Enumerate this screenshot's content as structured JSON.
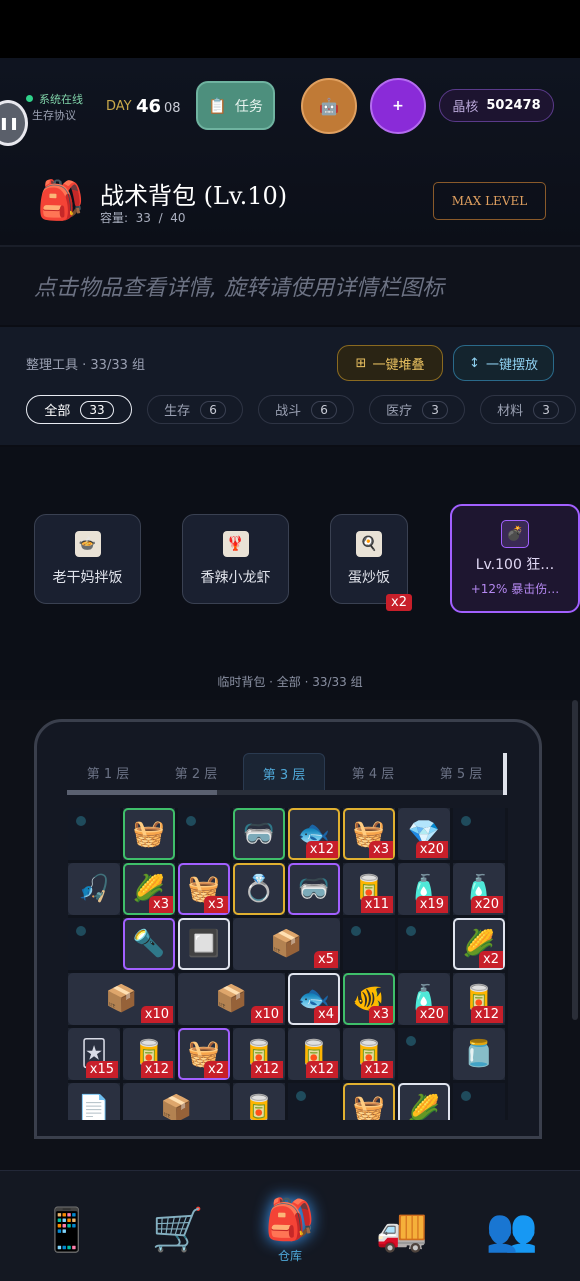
{
  "hud": {
    "status_online": "系统在线",
    "protocol": "生存协议",
    "day_label": "DAY",
    "day_number": "46",
    "day_sub": "08",
    "task_label": "任务",
    "plus_label": "+",
    "core_label": "晶核",
    "core_value": "502478"
  },
  "backpack": {
    "title": "战术背包 (Lv.10)",
    "capacity": "容量:  33  /  40",
    "max_level": "MAX LEVEL"
  },
  "hint": "点击物品查看详情, 旋转请使用详情栏图标",
  "tools": {
    "title": "整理工具 · 33/33 组",
    "stack_label": "一键堆叠",
    "place_label": "一键摆放"
  },
  "filters": [
    {
      "label": "全部",
      "count": "33"
    },
    {
      "label": "生存",
      "count": "6"
    },
    {
      "label": "战斗",
      "count": "6"
    },
    {
      "label": "医疗",
      "count": "3"
    },
    {
      "label": "材料",
      "count": "3"
    }
  ],
  "temp_items": [
    {
      "label": "老干妈拌饭",
      "icon": "bowl-icon"
    },
    {
      "label": "香辣小龙虾",
      "icon": "crayfish-icon"
    },
    {
      "label": "蛋炒饭",
      "icon": "fried-rice-icon",
      "badge": "x2"
    }
  ],
  "feature_card": {
    "title": "Lv.100 狂…",
    "sub": "+12% 暴击伤…"
  },
  "temp_bag_caption": "临时背包 · 全部 · 33/33 组",
  "layers": [
    "第 1 层",
    "第 2 层",
    "第 3 层",
    "第 4 层",
    "第 5 层"
  ],
  "active_layer": 2,
  "grid_items": [
    {
      "icon": "tomato-basket-icon",
      "glyph": "🧺",
      "frame": "green",
      "badge": ""
    },
    {
      "icon": "goggles-icon",
      "glyph": "🥽",
      "frame": "green",
      "badge": ""
    },
    {
      "icon": "fish-icon",
      "glyph": "🐟",
      "frame": "gold",
      "badge": "x12"
    },
    {
      "icon": "tomato-basket-icon",
      "glyph": "🧺",
      "frame": "gold",
      "badge": "x3"
    },
    {
      "icon": "red-crystal-icon",
      "glyph": "💎",
      "frame": "plain",
      "badge": "x20"
    },
    {
      "icon": "fishing-rod-icon",
      "glyph": "🎣",
      "frame": "plain",
      "badge": ""
    },
    {
      "icon": "corn-basket-icon",
      "glyph": "🌽",
      "frame": "green",
      "badge": "x3"
    },
    {
      "icon": "tomato-basket-icon",
      "glyph": "🧺",
      "frame": "purple",
      "badge": "x3"
    },
    {
      "icon": "ring-icon",
      "glyph": "💍",
      "frame": "gold",
      "badge": ""
    },
    {
      "icon": "goggles-icon",
      "glyph": "🥽",
      "frame": "purple",
      "badge": ""
    },
    {
      "icon": "soda-can-icon",
      "glyph": "🥫",
      "frame": "plain",
      "badge": "x11"
    },
    {
      "icon": "water-bottle-icon",
      "glyph": "🧴",
      "frame": "plain",
      "badge": "x19"
    },
    {
      "icon": "water-bottle-icon",
      "glyph": "🧴",
      "frame": "plain",
      "badge": "x20"
    },
    {
      "icon": "lantern-icon",
      "glyph": "🔦",
      "frame": "purple",
      "badge": ""
    },
    {
      "icon": "chip-icon",
      "glyph": "🔲",
      "frame": "white",
      "badge": ""
    },
    {
      "icon": "ammo-box-icon",
      "glyph": "📦",
      "frame": "plain",
      "badge": "x5"
    },
    {
      "icon": "corn-basket-icon",
      "glyph": "🌽",
      "frame": "white",
      "badge": "x2"
    },
    {
      "icon": "ammo-box-icon",
      "glyph": "📦",
      "frame": "plain",
      "badge": "x10"
    },
    {
      "icon": "ammo-box-icon",
      "glyph": "📦",
      "frame": "plain",
      "badge": "x10"
    },
    {
      "icon": "fish-icon",
      "glyph": "🐟",
      "frame": "white",
      "badge": "x4"
    },
    {
      "icon": "yellow-fish-icon",
      "glyph": "🐠",
      "frame": "green",
      "badge": "x3"
    },
    {
      "icon": "water-bottle-icon",
      "glyph": "🧴",
      "frame": "plain",
      "badge": "x20"
    },
    {
      "icon": "soda-can-icon",
      "glyph": "🥫",
      "frame": "plain",
      "badge": "x12"
    },
    {
      "icon": "cards-icon",
      "glyph": "🃏",
      "frame": "plain",
      "badge": "x15"
    },
    {
      "icon": "soda-can-icon",
      "glyph": "🥫",
      "frame": "plain",
      "badge": "x12"
    },
    {
      "icon": "tomato-basket-icon",
      "glyph": "🧺",
      "frame": "purple",
      "badge": "x2"
    },
    {
      "icon": "soda-can-icon",
      "glyph": "🥫",
      "frame": "plain",
      "badge": "x12"
    },
    {
      "icon": "soda-can-icon",
      "glyph": "🥫",
      "frame": "plain",
      "badge": "x12"
    },
    {
      "icon": "soda-can-icon",
      "glyph": "🥫",
      "frame": "plain",
      "badge": "x12"
    },
    {
      "icon": "jar-icon",
      "glyph": "🫙",
      "frame": "plain",
      "badge": ""
    },
    {
      "icon": "paper-bag-icon",
      "glyph": "📄",
      "frame": "plain",
      "badge": ""
    },
    {
      "icon": "ammo-box-icon",
      "glyph": "📦",
      "frame": "plain",
      "badge": ""
    },
    {
      "icon": "soda-can-icon",
      "glyph": "🥫",
      "frame": "plain",
      "badge": ""
    },
    {
      "icon": "tomato-basket-icon",
      "glyph": "🧺",
      "frame": "gold",
      "badge": ""
    },
    {
      "icon": "corn-basket-icon",
      "glyph": "🌽",
      "frame": "white",
      "badge": ""
    }
  ],
  "nav": [
    {
      "icon": "phone-icon",
      "glyph": "📱",
      "label": ""
    },
    {
      "icon": "cart-icon",
      "glyph": "🛒",
      "label": ""
    },
    {
      "icon": "backpack-icon",
      "glyph": "🎒",
      "label": "仓库"
    },
    {
      "icon": "truck-icon",
      "glyph": "🚚",
      "label": ""
    },
    {
      "icon": "friends-icon",
      "glyph": "👥",
      "label": ""
    }
  ],
  "colors": {
    "task_button": "#4d8f7d",
    "orange_button": "#d08a3a",
    "purple_button": "#8a2bd8",
    "badge_red": "#c81f2a",
    "accent_blue": "#4fa8d8"
  }
}
